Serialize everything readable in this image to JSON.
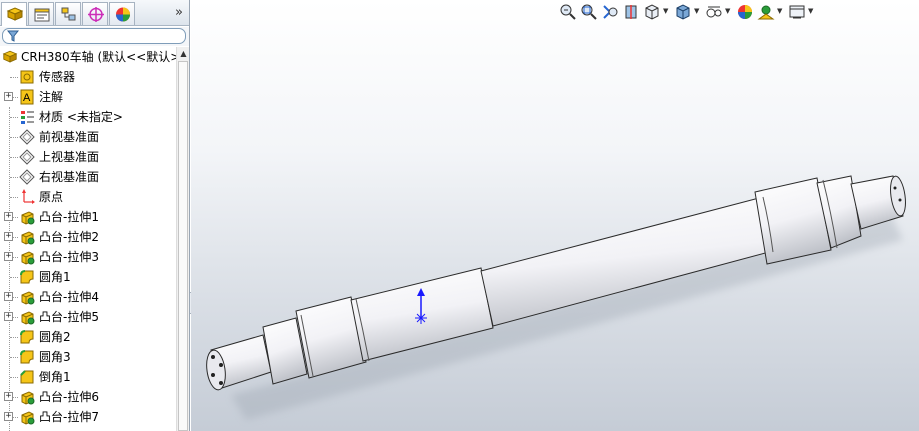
{
  "panel_tabs": {
    "feature_manager": "feature-manager-icon",
    "property_manager": "property-manager-icon",
    "configuration_manager": "configuration-manager-icon",
    "dimxpert_manager": "dimxpert-icon",
    "display_manager": "display-manager-icon",
    "more": "»"
  },
  "filter": {
    "icon": "filter-icon",
    "value": ""
  },
  "tree": {
    "root": "CRH380车轴 (默认<<默认>",
    "items": [
      {
        "label": "传感器",
        "icon": "sensor-icon",
        "expandable": false
      },
      {
        "label": "注解",
        "icon": "annotation-icon",
        "expandable": true
      },
      {
        "label": "材质 <未指定>",
        "icon": "material-icon",
        "expandable": false
      },
      {
        "label": "前视基准面",
        "icon": "plane-icon",
        "expandable": false
      },
      {
        "label": "上视基准面",
        "icon": "plane-icon",
        "expandable": false
      },
      {
        "label": "右视基准面",
        "icon": "plane-icon",
        "expandable": false
      },
      {
        "label": "原点",
        "icon": "origin-icon",
        "expandable": false
      },
      {
        "label": "凸台-拉伸1",
        "icon": "extrude-icon",
        "expandable": true
      },
      {
        "label": "凸台-拉伸2",
        "icon": "extrude-icon",
        "expandable": true
      },
      {
        "label": "凸台-拉伸3",
        "icon": "extrude-icon",
        "expandable": true
      },
      {
        "label": "圆角1",
        "icon": "fillet-icon",
        "expandable": false
      },
      {
        "label": "凸台-拉伸4",
        "icon": "extrude-icon",
        "expandable": true
      },
      {
        "label": "凸台-拉伸5",
        "icon": "extrude-icon",
        "expandable": true
      },
      {
        "label": "圆角2",
        "icon": "fillet-icon",
        "expandable": false
      },
      {
        "label": "圆角3",
        "icon": "fillet-icon",
        "expandable": false
      },
      {
        "label": "倒角1",
        "icon": "chamfer-icon",
        "expandable": false
      },
      {
        "label": "凸台-拉伸6",
        "icon": "extrude-icon",
        "expandable": true
      },
      {
        "label": "凸台-拉伸7",
        "icon": "extrude-icon",
        "expandable": true
      }
    ]
  },
  "heads_up_toolbar": [
    "zoom-to-fit-icon",
    "zoom-to-area-icon",
    "previous-view-icon",
    "section-view-icon",
    "view-orientation-icon",
    "display-style-icon",
    "hide-show-items-icon",
    "edit-appearance-icon",
    "apply-scene-icon",
    "view-settings-icon"
  ],
  "colors": {
    "tab_accent": "#f0b400",
    "dimxpert": "#cc2db8",
    "axis_blue": "#1a1aff",
    "model_body": "#f7f7fa"
  }
}
